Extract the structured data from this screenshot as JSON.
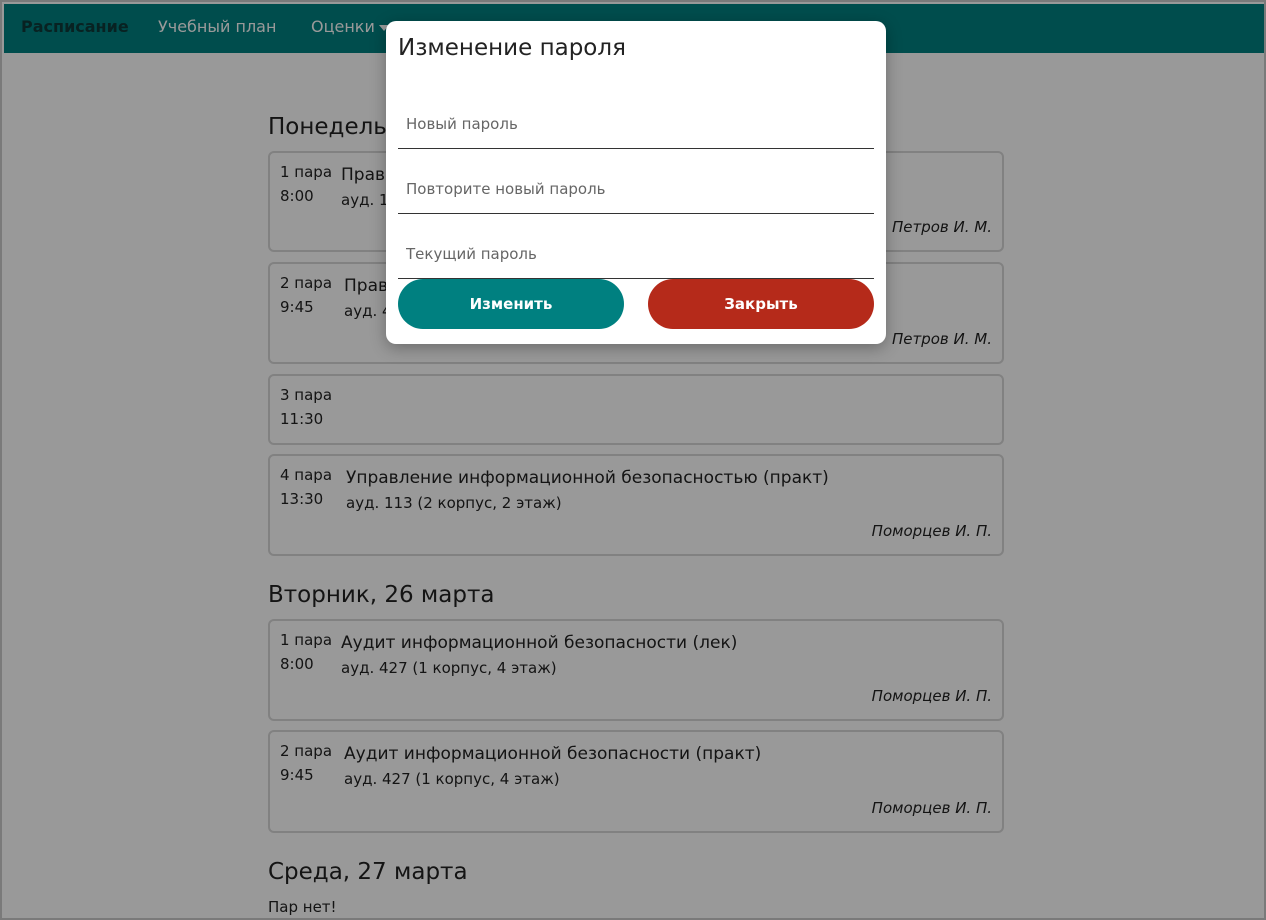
{
  "nav": {
    "items": [
      "Расписание",
      "Учебный план",
      "Оценки"
    ]
  },
  "schedule": {
    "days": [
      {
        "title": "Понедельник",
        "lessons": [
          {
            "num": "1 пара",
            "time": "8:00",
            "subject": "Прав",
            "room": "ауд. 11",
            "teacher": "Петров И. М."
          },
          {
            "num": "2 пара",
            "time": "9:45",
            "subject": "Прав",
            "room": "ауд. 4",
            "teacher": "Петров И. М."
          },
          {
            "num": "3 пара",
            "time": "11:30",
            "subject": "",
            "room": "",
            "teacher": ""
          },
          {
            "num": "4 пара",
            "time": "13:30",
            "subject": "Управление информационной безопасностью (практ)",
            "room": "ауд. 113 (2 корпус, 2 этаж)",
            "teacher": "Поморцев И. П."
          }
        ]
      },
      {
        "title": "Вторник, 26 марта",
        "lessons": [
          {
            "num": "1 пара",
            "time": "8:00",
            "subject": "Аудит информационной безопасности (лек)",
            "room": "ауд. 427 (1 корпус, 4 этаж)",
            "teacher": "Поморцев И. П."
          },
          {
            "num": "2 пара",
            "time": "9:45",
            "subject": "Аудит информационной безопасности (практ)",
            "room": "ауд. 427 (1 корпус, 4 этаж)",
            "teacher": "Поморцев И. П."
          }
        ]
      },
      {
        "title": "Среда, 27 марта",
        "empty": "Пар нет!"
      }
    ]
  },
  "modal": {
    "title": "Изменение пароля",
    "new_password_placeholder": "Новый пароль",
    "repeat_password_placeholder": "Повторите новый пароль",
    "current_password_placeholder": "Текущий пароль",
    "submit_label": "Изменить",
    "close_label": "Закрыть"
  },
  "colors": {
    "primary": "#008080",
    "danger": "#b52a1a"
  }
}
